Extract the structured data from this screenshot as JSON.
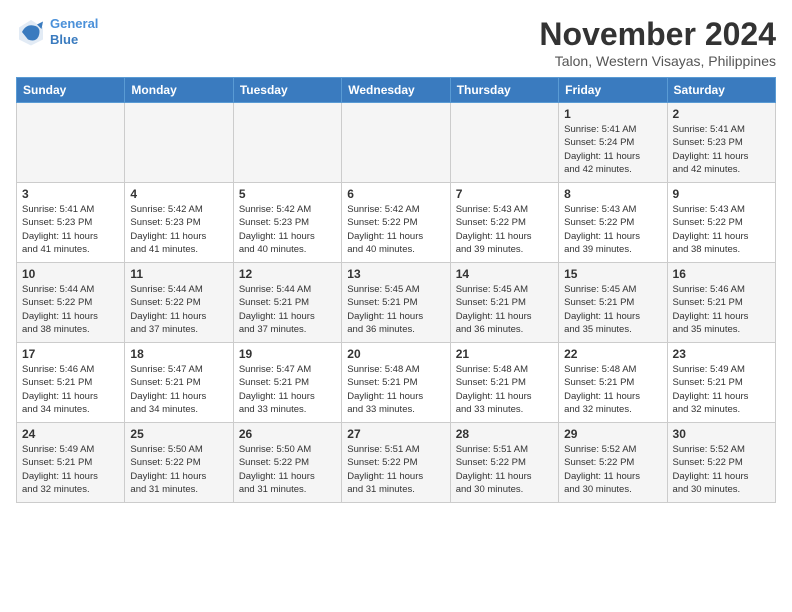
{
  "header": {
    "logo_line1": "General",
    "logo_line2": "Blue",
    "month": "November 2024",
    "location": "Talon, Western Visayas, Philippines"
  },
  "weekdays": [
    "Sunday",
    "Monday",
    "Tuesday",
    "Wednesday",
    "Thursday",
    "Friday",
    "Saturday"
  ],
  "weeks": [
    [
      {
        "day": "",
        "info": ""
      },
      {
        "day": "",
        "info": ""
      },
      {
        "day": "",
        "info": ""
      },
      {
        "day": "",
        "info": ""
      },
      {
        "day": "",
        "info": ""
      },
      {
        "day": "1",
        "info": "Sunrise: 5:41 AM\nSunset: 5:24 PM\nDaylight: 11 hours\nand 42 minutes."
      },
      {
        "day": "2",
        "info": "Sunrise: 5:41 AM\nSunset: 5:23 PM\nDaylight: 11 hours\nand 42 minutes."
      }
    ],
    [
      {
        "day": "3",
        "info": "Sunrise: 5:41 AM\nSunset: 5:23 PM\nDaylight: 11 hours\nand 41 minutes."
      },
      {
        "day": "4",
        "info": "Sunrise: 5:42 AM\nSunset: 5:23 PM\nDaylight: 11 hours\nand 41 minutes."
      },
      {
        "day": "5",
        "info": "Sunrise: 5:42 AM\nSunset: 5:23 PM\nDaylight: 11 hours\nand 40 minutes."
      },
      {
        "day": "6",
        "info": "Sunrise: 5:42 AM\nSunset: 5:22 PM\nDaylight: 11 hours\nand 40 minutes."
      },
      {
        "day": "7",
        "info": "Sunrise: 5:43 AM\nSunset: 5:22 PM\nDaylight: 11 hours\nand 39 minutes."
      },
      {
        "day": "8",
        "info": "Sunrise: 5:43 AM\nSunset: 5:22 PM\nDaylight: 11 hours\nand 39 minutes."
      },
      {
        "day": "9",
        "info": "Sunrise: 5:43 AM\nSunset: 5:22 PM\nDaylight: 11 hours\nand 38 minutes."
      }
    ],
    [
      {
        "day": "10",
        "info": "Sunrise: 5:44 AM\nSunset: 5:22 PM\nDaylight: 11 hours\nand 38 minutes."
      },
      {
        "day": "11",
        "info": "Sunrise: 5:44 AM\nSunset: 5:22 PM\nDaylight: 11 hours\nand 37 minutes."
      },
      {
        "day": "12",
        "info": "Sunrise: 5:44 AM\nSunset: 5:21 PM\nDaylight: 11 hours\nand 37 minutes."
      },
      {
        "day": "13",
        "info": "Sunrise: 5:45 AM\nSunset: 5:21 PM\nDaylight: 11 hours\nand 36 minutes."
      },
      {
        "day": "14",
        "info": "Sunrise: 5:45 AM\nSunset: 5:21 PM\nDaylight: 11 hours\nand 36 minutes."
      },
      {
        "day": "15",
        "info": "Sunrise: 5:45 AM\nSunset: 5:21 PM\nDaylight: 11 hours\nand 35 minutes."
      },
      {
        "day": "16",
        "info": "Sunrise: 5:46 AM\nSunset: 5:21 PM\nDaylight: 11 hours\nand 35 minutes."
      }
    ],
    [
      {
        "day": "17",
        "info": "Sunrise: 5:46 AM\nSunset: 5:21 PM\nDaylight: 11 hours\nand 34 minutes."
      },
      {
        "day": "18",
        "info": "Sunrise: 5:47 AM\nSunset: 5:21 PM\nDaylight: 11 hours\nand 34 minutes."
      },
      {
        "day": "19",
        "info": "Sunrise: 5:47 AM\nSunset: 5:21 PM\nDaylight: 11 hours\nand 33 minutes."
      },
      {
        "day": "20",
        "info": "Sunrise: 5:48 AM\nSunset: 5:21 PM\nDaylight: 11 hours\nand 33 minutes."
      },
      {
        "day": "21",
        "info": "Sunrise: 5:48 AM\nSunset: 5:21 PM\nDaylight: 11 hours\nand 33 minutes."
      },
      {
        "day": "22",
        "info": "Sunrise: 5:48 AM\nSunset: 5:21 PM\nDaylight: 11 hours\nand 32 minutes."
      },
      {
        "day": "23",
        "info": "Sunrise: 5:49 AM\nSunset: 5:21 PM\nDaylight: 11 hours\nand 32 minutes."
      }
    ],
    [
      {
        "day": "24",
        "info": "Sunrise: 5:49 AM\nSunset: 5:21 PM\nDaylight: 11 hours\nand 32 minutes."
      },
      {
        "day": "25",
        "info": "Sunrise: 5:50 AM\nSunset: 5:22 PM\nDaylight: 11 hours\nand 31 minutes."
      },
      {
        "day": "26",
        "info": "Sunrise: 5:50 AM\nSunset: 5:22 PM\nDaylight: 11 hours\nand 31 minutes."
      },
      {
        "day": "27",
        "info": "Sunrise: 5:51 AM\nSunset: 5:22 PM\nDaylight: 11 hours\nand 31 minutes."
      },
      {
        "day": "28",
        "info": "Sunrise: 5:51 AM\nSunset: 5:22 PM\nDaylight: 11 hours\nand 30 minutes."
      },
      {
        "day": "29",
        "info": "Sunrise: 5:52 AM\nSunset: 5:22 PM\nDaylight: 11 hours\nand 30 minutes."
      },
      {
        "day": "30",
        "info": "Sunrise: 5:52 AM\nSunset: 5:22 PM\nDaylight: 11 hours\nand 30 minutes."
      }
    ]
  ]
}
